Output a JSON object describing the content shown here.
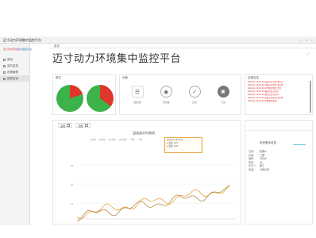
{
  "window": {
    "title": "迈寸动力环境集中监控平台",
    "buttons": [
      "—",
      "□",
      "×"
    ]
  },
  "sidebar": {
    "logo_red": "迈寸动力环境",
    "logo_blue": "集中监控平台",
    "items": [
      {
        "label": "首页"
      },
      {
        "label": "实时监控"
      },
      {
        "label": "告警管理"
      },
      {
        "label": "报表查询"
      }
    ]
  },
  "header": {
    "home_tab": "首页",
    "title": "迈寸动力环境集中监控平台",
    "expand_icon": "expand-icon"
  },
  "status_panel": {
    "title": "概况",
    "pies": [
      {
        "online_pct": 80,
        "offline_pct": 20
      },
      {
        "online_pct": 65,
        "offline_pct": 35
      }
    ],
    "colors": {
      "online": "#3cb34a",
      "offline": "#e0352b"
    }
  },
  "device_panel": {
    "title": "设备",
    "devices": [
      {
        "icon": "server-icon",
        "label": "服务器"
      },
      {
        "icon": "signal-icon",
        "label": "传感器"
      },
      {
        "icon": "check-icon",
        "label": "正常"
      },
      {
        "icon": "lock-icon",
        "label": "门禁"
      }
    ]
  },
  "alarm_panel": {
    "title": "告警信息",
    "alarms": [
      "2019-01-18 10:21 温度过高告警 机房A",
      "2019-01-18 10:20 湿度异常告警 机房B",
      "2019-01-18 10:18 UPS电池电压告警",
      "2019-01-18 10:15 烟感告警 机房A",
      "2019-01-18 10:12 漏水告警 机房C",
      "2019-01-18 10:10 温度过高告警 机房B",
      "2019-01-18 10:08 市电断电告警"
    ]
  },
  "trend_panel": {
    "tabs": [
      {
        "label": "温度",
        "checked": true
      },
      {
        "label": "湿度",
        "checked": true
      }
    ],
    "title": "温湿度实时曲线",
    "legend": [
      "1小时",
      "6小时",
      "12小时",
      "24小时",
      "一周",
      "一月"
    ],
    "tooltip": [
      "2019-01-18 10:21",
      "● 温度: 24.5",
      "● 湿度: 23.8"
    ],
    "ylabels": [
      "30",
      "20",
      "10"
    ],
    "colors": {
      "temp": "#e8a33a",
      "humidity": "#b58d4a"
    }
  },
  "info_panel": {
    "title": "机房基本信息",
    "rows": [
      {
        "k": "名称:",
        "v": "机房A"
      },
      {
        "k": "位置:",
        "v": "三层"
      },
      {
        "k": "面积:",
        "v": "120㎡"
      },
      {
        "k": "机柜:",
        "v": "24"
      },
      {
        "k": "负责人:",
        "v": "张工"
      },
      {
        "k": "电话:",
        "v": "1380000"
      }
    ]
  }
}
